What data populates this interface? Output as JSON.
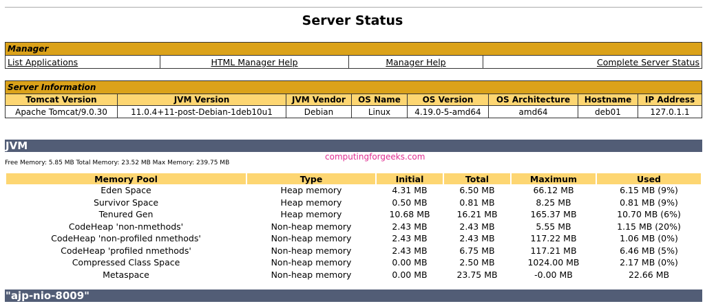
{
  "title": "Server Status",
  "manager": {
    "heading": "Manager",
    "links": [
      "List Applications",
      "HTML Manager Help",
      "Manager Help",
      "Complete Server Status"
    ]
  },
  "server_info": {
    "heading": "Server Information",
    "columns": [
      "Tomcat Version",
      "JVM Version",
      "JVM Vendor",
      "OS Name",
      "OS Version",
      "OS Architecture",
      "Hostname",
      "IP Address"
    ],
    "values": [
      "Apache Tomcat/9.0.30",
      "11.0.4+11-post-Debian-1deb10u1",
      "Debian",
      "Linux",
      "4.19.0-5-amd64",
      "amd64",
      "deb01",
      "127.0.1.1"
    ]
  },
  "jvm": {
    "heading": "JVM",
    "memory_line": "Free Memory: 5.85 MB Total Memory: 23.52 MB Max Memory: 239.75 MB",
    "columns": [
      "Memory Pool",
      "Type",
      "Initial",
      "Total",
      "Maximum",
      "Used"
    ],
    "rows": [
      [
        "Eden Space",
        "Heap memory",
        "4.31 MB",
        "6.50 MB",
        "66.12 MB",
        "6.15 MB (9%)"
      ],
      [
        "Survivor Space",
        "Heap memory",
        "0.50 MB",
        "0.81 MB",
        "8.25 MB",
        "0.81 MB (9%)"
      ],
      [
        "Tenured Gen",
        "Heap memory",
        "10.68 MB",
        "16.21 MB",
        "165.37 MB",
        "10.70 MB (6%)"
      ],
      [
        "CodeHeap 'non-nmethods'",
        "Non-heap memory",
        "2.43 MB",
        "2.43 MB",
        "5.55 MB",
        "1.15 MB (20%)"
      ],
      [
        "CodeHeap 'non-profiled nmethods'",
        "Non-heap memory",
        "2.43 MB",
        "2.43 MB",
        "117.22 MB",
        "1.06 MB (0%)"
      ],
      [
        "CodeHeap 'profiled nmethods'",
        "Non-heap memory",
        "2.43 MB",
        "6.75 MB",
        "117.21 MB",
        "6.46 MB (5%)"
      ],
      [
        "Compressed Class Space",
        "Non-heap memory",
        "0.00 MB",
        "2.50 MB",
        "1024.00 MB",
        "2.17 MB (0%)"
      ],
      [
        "Metaspace",
        "Non-heap memory",
        "0.00 MB",
        "23.75 MB",
        "-0.00 MB",
        "22.66 MB"
      ]
    ]
  },
  "watermark": "computingforgeeks.com",
  "connector_heading": "\"ajp-nio-8009\"",
  "colors": {
    "section_title": "#dba21a",
    "header_row": "#fdd672",
    "band": "#525d76",
    "watermark": "#e02c90"
  }
}
